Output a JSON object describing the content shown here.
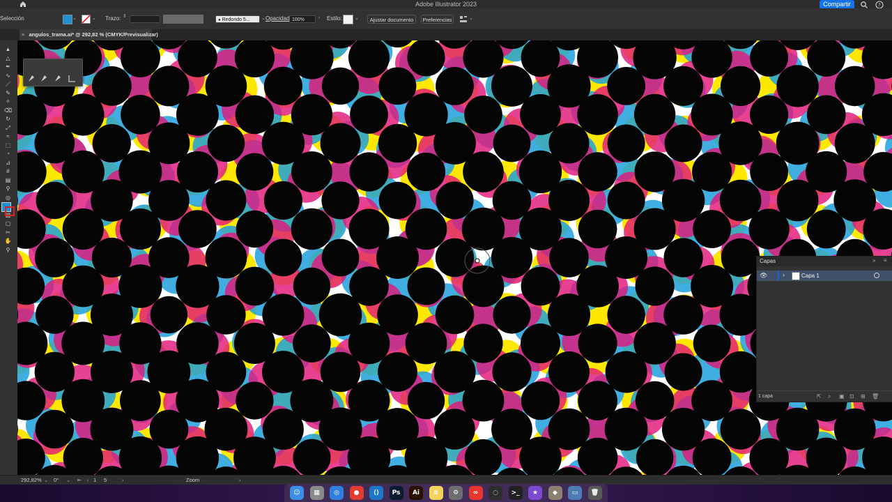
{
  "app": {
    "window_title": "Adobe Illustrator 2023",
    "share_label": "Compartir"
  },
  "control_bar": {
    "selection_label": "Selección",
    "fill_color": "#1e90d4",
    "stroke_label": "Trazo:",
    "brush_value": "Redondo 5...",
    "opacity_label": "Opacidad:",
    "opacity_value": "100%",
    "style_label": "Estilo:",
    "adjust_document_label": "Ajustar documento",
    "preferences_label": "Preferencias"
  },
  "document": {
    "tab_title": "angulos_trama.ai* @ 292,82 % (CMYK/Previsualizar)",
    "close_glyph": "×"
  },
  "tools": [
    "selection-tool",
    "direct-selection-tool",
    "pen-tool",
    "curvature-tool",
    "line-tool",
    "paintbrush-tool",
    "shaper-tool",
    "eraser-tool",
    "rotate-tool",
    "scale-tool",
    "warp-tool",
    "free-transform-tool",
    "shape-builder-tool",
    "perspective-tool",
    "mesh-tool",
    "gradient-tool",
    "eyedropper-tool",
    "blend-tool",
    "symbol-sprayer-tool",
    "column-graph-tool",
    "artboard-tool",
    "slice-tool",
    "hand-tool",
    "zoom-tool"
  ],
  "layers_panel": {
    "title": "Capas",
    "layer_name": "Capa 1",
    "footer_count": "1 capa"
  },
  "status_bar": {
    "zoom": "292,82%",
    "rotation": "0°",
    "artboard": "1",
    "page_nav": "5",
    "mode": "Zoom"
  },
  "canvas": {
    "colors": {
      "cyan": "#1ea0dc",
      "magenta": "#e2197a",
      "yellow": "#ffe800",
      "black": "#050505"
    }
  },
  "dock": [
    {
      "name": "finder",
      "glyph": "☺",
      "color": "#3a8ee6"
    },
    {
      "name": "launchpad",
      "glyph": "▦",
      "color": "#8a8a8a"
    },
    {
      "name": "safari",
      "glyph": "◎",
      "color": "#2f7fe0"
    },
    {
      "name": "chrome",
      "glyph": "●",
      "color": "#e23b2f"
    },
    {
      "name": "vscode",
      "glyph": "⟨⟩",
      "color": "#1f76c8"
    },
    {
      "name": "photoshop",
      "glyph": "Ps",
      "color": "#0b1b31"
    },
    {
      "name": "illustrator",
      "glyph": "Ai",
      "color": "#2b1200"
    },
    {
      "name": "notes",
      "glyph": "≡",
      "color": "#f2d45c"
    },
    {
      "name": "system-preferences",
      "glyph": "⚙",
      "color": "#6d6d6d"
    },
    {
      "name": "creative-cloud",
      "glyph": "∞",
      "color": "#e8352f"
    },
    {
      "name": "activity",
      "glyph": "◌",
      "color": "#2d2d2d"
    },
    {
      "name": "terminal",
      "glyph": ">_",
      "color": "#222222"
    },
    {
      "name": "imovie",
      "glyph": "★",
      "color": "#7a4bd1"
    },
    {
      "name": "gimp",
      "glyph": "◆",
      "color": "#8c8070"
    },
    {
      "name": "preview",
      "glyph": "▭",
      "color": "#4d7bb3"
    },
    {
      "name": "trash",
      "glyph": "🗑",
      "color": "#5a5a5a"
    }
  ]
}
